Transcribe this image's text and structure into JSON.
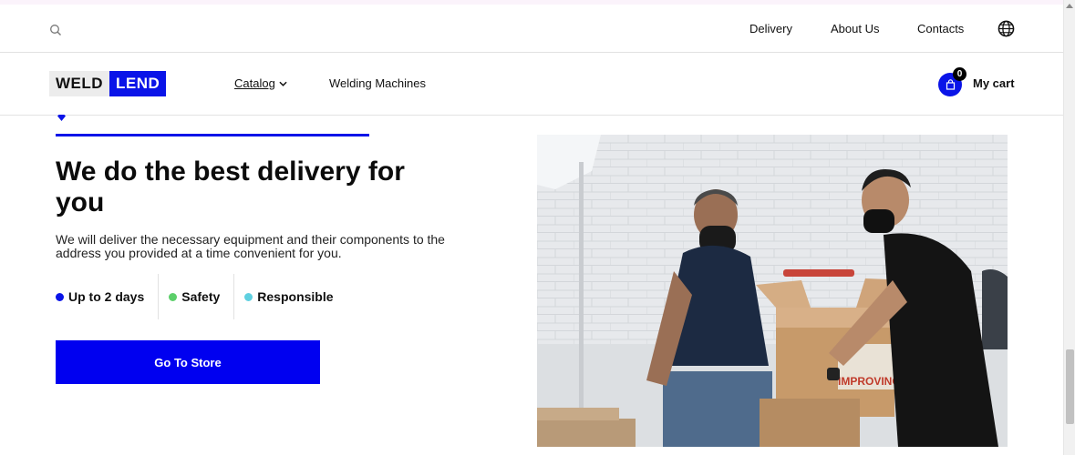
{
  "topbar": {
    "nav": [
      {
        "label": "Delivery"
      },
      {
        "label": "About Us"
      },
      {
        "label": "Contacts"
      }
    ]
  },
  "header": {
    "logo": {
      "part1": "WELD",
      "part2": "LEND"
    },
    "catalog_label": "Catalog",
    "welding_label": "Welding Machines",
    "cart": {
      "count": "0",
      "label": "My cart"
    }
  },
  "hero": {
    "title": "We do the best delivery for you",
    "description": "We will deliver the necessary equipment and their components to the address you provided at a time convenient for you.",
    "features": [
      {
        "label": "Up to 2 days",
        "color": "#0a14e8"
      },
      {
        "label": "Safety",
        "color": "#5ccf6a"
      },
      {
        "label": "Responsible",
        "color": "#5fd0e0"
      }
    ],
    "cta_label": "Go To Store",
    "image_text": "IMPROVING"
  },
  "colors": {
    "accent": "#0a14e8",
    "cta": "#0000f0"
  }
}
